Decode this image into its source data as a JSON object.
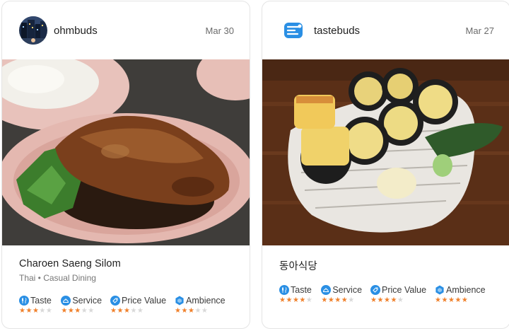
{
  "posts": [
    {
      "username": "ohmbuds",
      "date": "Mar 30",
      "avatar_icon": "city-night-avatar",
      "photo_subject": "braised-pork-leg-on-rice",
      "restaurant": "Charoen Saeng Silom",
      "subtitle": "Thai • Casual Dining",
      "ratings": [
        {
          "label": "Taste",
          "icon": "utensils-icon",
          "stars": 3,
          "max": 5
        },
        {
          "label": "Service",
          "icon": "cloche-icon",
          "stars": 3,
          "max": 5
        },
        {
          "label": "Price Value",
          "icon": "price-tag-icon",
          "stars": 3,
          "max": 5
        },
        {
          "label": "Ambience",
          "icon": "hexagon-icon",
          "stars": 3,
          "max": 5
        }
      ]
    },
    {
      "username": "tastebuds",
      "date": "Mar 27",
      "avatar_icon": "tastebuds-logo",
      "photo_subject": "kimbap-plate",
      "restaurant": "동아식당",
      "subtitle": "",
      "ratings": [
        {
          "label": "Taste",
          "icon": "utensils-icon",
          "stars": 4,
          "max": 5
        },
        {
          "label": "Service",
          "icon": "cloche-icon",
          "stars": 4,
          "max": 5
        },
        {
          "label": "Price Value",
          "icon": "price-tag-icon",
          "stars": 4,
          "max": 5
        },
        {
          "label": "Ambience",
          "icon": "hexagon-icon",
          "stars": 5,
          "max": 5
        }
      ]
    }
  ],
  "colors": {
    "accent": "#2a8fe4",
    "star_on": "#f0812c",
    "star_off": "#d8d8d8",
    "card_border": "#e4e4e4"
  }
}
